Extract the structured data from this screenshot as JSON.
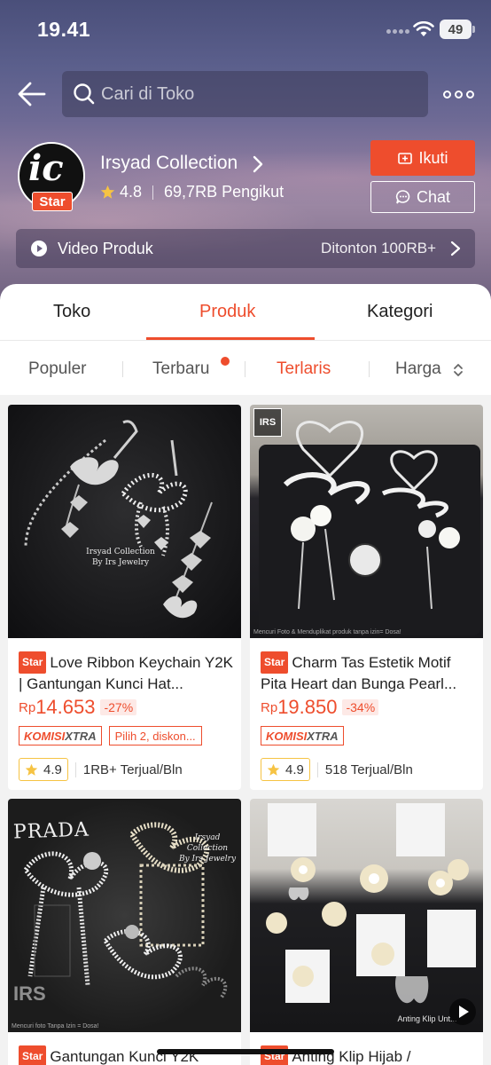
{
  "status": {
    "time": "19.41",
    "battery": "49"
  },
  "search": {
    "placeholder": "Cari di Toko"
  },
  "shop": {
    "name": "Irsyad Collection",
    "avatar_mark": "ic",
    "badge": "Star",
    "rating": "4.8",
    "followers": "69,7RB Pengikut",
    "follow_label": "Ikuti",
    "chat_label": "Chat"
  },
  "video": {
    "label": "Video Produk",
    "views": "Ditonton 100RB+"
  },
  "tabs": [
    {
      "label": "Toko"
    },
    {
      "label": "Produk",
      "active": true
    },
    {
      "label": "Kategori"
    }
  ],
  "sort": [
    {
      "label": "Populer"
    },
    {
      "label": "Terbaru"
    },
    {
      "label": "Terlaris",
      "active": true
    },
    {
      "label": "Harga"
    }
  ],
  "products": [
    {
      "badge": "Star",
      "title": "Love Ribbon Keychain Y2K | Gantungan Kunci Hat...",
      "currency": "Rp",
      "price": "14.653",
      "discount": "-27%",
      "komisi_a": "KOMISI",
      "komisi_b": "XTRA",
      "promo": "Pilih 2, diskon...",
      "rating": "4.9",
      "sold": "1RB+ Terjual/Bln",
      "caption": "Irsyad Collection\nBy Irs Jewelry"
    },
    {
      "badge": "Star",
      "title": "Charm Tas Estetik Motif Pita Heart dan Bunga Pearl...",
      "currency": "Rp",
      "price": "19.850",
      "discount": "-34%",
      "komisi_a": "KOMISI",
      "komisi_b": "XTRA",
      "rating": "4.9",
      "sold": "518 Terjual/Bln",
      "logo": "IRS",
      "watermark": "Mencuri Foto & Menduplikat produk tanpa izin= Dosa!"
    },
    {
      "badge": "Star",
      "title": "Gantungan Kunci Y2K",
      "logo": "PRADA",
      "caption": "Irsyad Collection\nBy Irs Jewelry",
      "irs_mark": "IRS",
      "watermark": "Mencuri foto Tanpa Izin = Dosa!"
    },
    {
      "badge": "Star",
      "title": "Anting Klip Hijab /",
      "caption": "Anting Klip Unt..."
    }
  ],
  "colors": {
    "accent": "#ee4d2d",
    "rating_border": "#f6c343"
  }
}
